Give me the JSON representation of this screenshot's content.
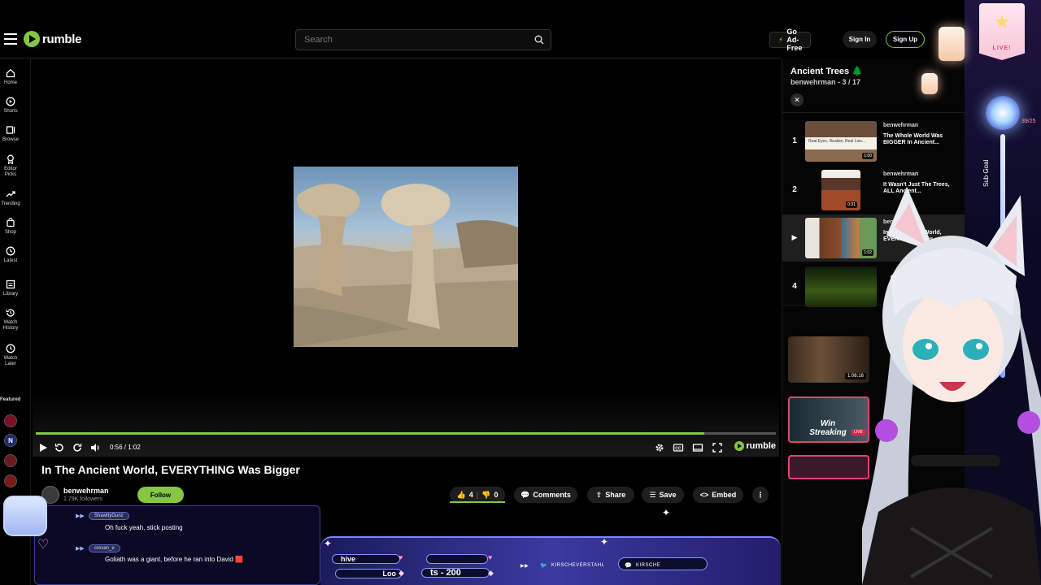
{
  "header": {
    "brand": "rumble",
    "search_placeholder": "Search",
    "go_ad_free": "Go Ad-Free",
    "sign_in": "Sign In",
    "sign_up": "Sign Up"
  },
  "sidebar": {
    "items": [
      {
        "label": "Home",
        "icon": "home-icon"
      },
      {
        "label": "Shorts",
        "icon": "shorts-icon"
      },
      {
        "label": "Browse",
        "icon": "browse-icon"
      },
      {
        "label": "Editor Picks",
        "icon": "award-icon"
      },
      {
        "label": "Trending",
        "icon": "trending-icon"
      },
      {
        "label": "Shop",
        "icon": "shop-icon"
      },
      {
        "label": "Latest",
        "icon": "clock-icon"
      },
      {
        "label": "Library",
        "icon": "library-icon"
      },
      {
        "label": "Watch History",
        "icon": "history-icon"
      },
      {
        "label": "Watch Later",
        "icon": "watch-later-icon"
      }
    ],
    "featured_label": "Featured"
  },
  "player": {
    "time": "0:56 / 1:02",
    "progress": 0.903,
    "brand": "rumble"
  },
  "video": {
    "title": "In The Ancient World, EVERYTHING Was Bigger",
    "channel": "benwehrman",
    "followers": "1.79K followers",
    "follow_label": "Follow",
    "likes": "4",
    "dislikes": "0",
    "comments_label": "Comments",
    "share_label": "Share",
    "save_label": "Save",
    "embed_label": "Embed"
  },
  "playlist": {
    "title": "Ancient Trees 🌲",
    "subtitle": "benwehrman  - 3 / 17",
    "items": [
      {
        "index": "1",
        "channel": "benwehrman",
        "title": "The Whole World Was BIGGER In Ancient...",
        "duration": "1:00",
        "thumb_text": "Real Eyes, Realise, Real Lies..."
      },
      {
        "index": "2",
        "channel": "benwehrman",
        "title": "It Wasn't Just The Trees, ALL Ancient...",
        "duration": "0:31"
      },
      {
        "index": "▶",
        "channel": "benwehrman",
        "title": "In The Ancient World, EVERYTHING Was...",
        "duration": "1:02"
      },
      {
        "index": "4",
        "channel": "",
        "title": "",
        "duration": ""
      }
    ],
    "recommended": [
      {
        "duration": "1:06:16"
      },
      {
        "title": "Win Streaking",
        "badge": "LIVE"
      }
    ]
  },
  "overlay": {
    "chat": [
      {
        "user": "ShawttyGunz",
        "message": "Oh fuck yeah, stick posting"
      },
      {
        "user": "crevan_e",
        "message": "Goliath was a giant, before he ran into David 🟥"
      }
    ],
    "widget_text_1": "hive",
    "widget_text_2": "Loo",
    "widget_text_3": "ts - 200",
    "tag_1": "KIRSCHEVERSTAHL",
    "tag_2": "KIRSCHE",
    "live_label": "LIVE!",
    "sub_goal": "39/25",
    "sub_goal_label": "Sub Goal"
  }
}
